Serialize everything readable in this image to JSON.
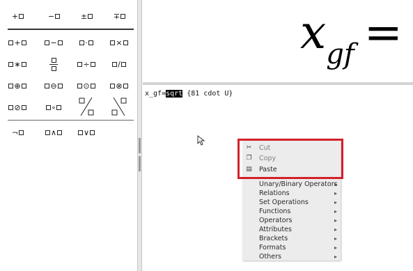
{
  "elements_panel": {
    "row1": [
      {
        "left": "",
        "op": "+",
        "right": ""
      },
      {
        "left": "",
        "op": "−",
        "right": ""
      },
      {
        "left": "",
        "op": "±",
        "right": ""
      },
      {
        "left": "",
        "op": "∓",
        "right": ""
      }
    ],
    "row2": [
      {
        "op": "+"
      },
      {
        "op": "−"
      },
      {
        "op": "·"
      },
      {
        "op": "×"
      }
    ],
    "row3": [
      {
        "op": "∗"
      },
      {
        "op": "frac"
      },
      {
        "op": "÷"
      },
      {
        "op": "/"
      }
    ],
    "row4": [
      {
        "op": "⊕"
      },
      {
        "op": "⊖"
      },
      {
        "op": "⊙"
      },
      {
        "op": "⊗"
      }
    ],
    "row5": [
      {
        "op": "⊘"
      },
      {
        "op": "∘"
      },
      {
        "op": "wideslash"
      },
      {
        "op": "widebslash"
      }
    ],
    "row6": [
      {
        "op": "¬"
      },
      {
        "op": "∧"
      },
      {
        "op": "∨"
      }
    ]
  },
  "preview": {
    "base": "x",
    "subscript": "gf",
    "equals": "="
  },
  "editor": {
    "prefix": "x_gf=",
    "selected": "sqrt",
    "suffix": " {81 cdot U}"
  },
  "context_menu": {
    "items": [
      {
        "label": "Cut",
        "icon": "scissors-icon",
        "glyph": "✂",
        "disabled": true,
        "submenu": false
      },
      {
        "label": "Copy",
        "icon": "copy-icon",
        "glyph": "❐",
        "disabled": true,
        "submenu": false
      },
      {
        "label": "Paste",
        "icon": "clipboard-icon",
        "glyph": "▤",
        "disabled": false,
        "submenu": false
      },
      {
        "label": "Unary/Binary Operators",
        "submenu": true
      },
      {
        "label": "Relations",
        "submenu": true
      },
      {
        "label": "Set Operations",
        "submenu": true
      },
      {
        "label": "Functions",
        "submenu": true
      },
      {
        "label": "Operators",
        "submenu": true
      },
      {
        "label": "Attributes",
        "submenu": true
      },
      {
        "label": "Brackets",
        "submenu": true
      },
      {
        "label": "Formats",
        "submenu": true
      },
      {
        "label": "Others",
        "submenu": true
      }
    ],
    "submenu_arrow": "▸"
  },
  "colors": {
    "highlight_border": "#d32028",
    "menu_bg": "#ececec",
    "selection_bg": "#000000"
  }
}
